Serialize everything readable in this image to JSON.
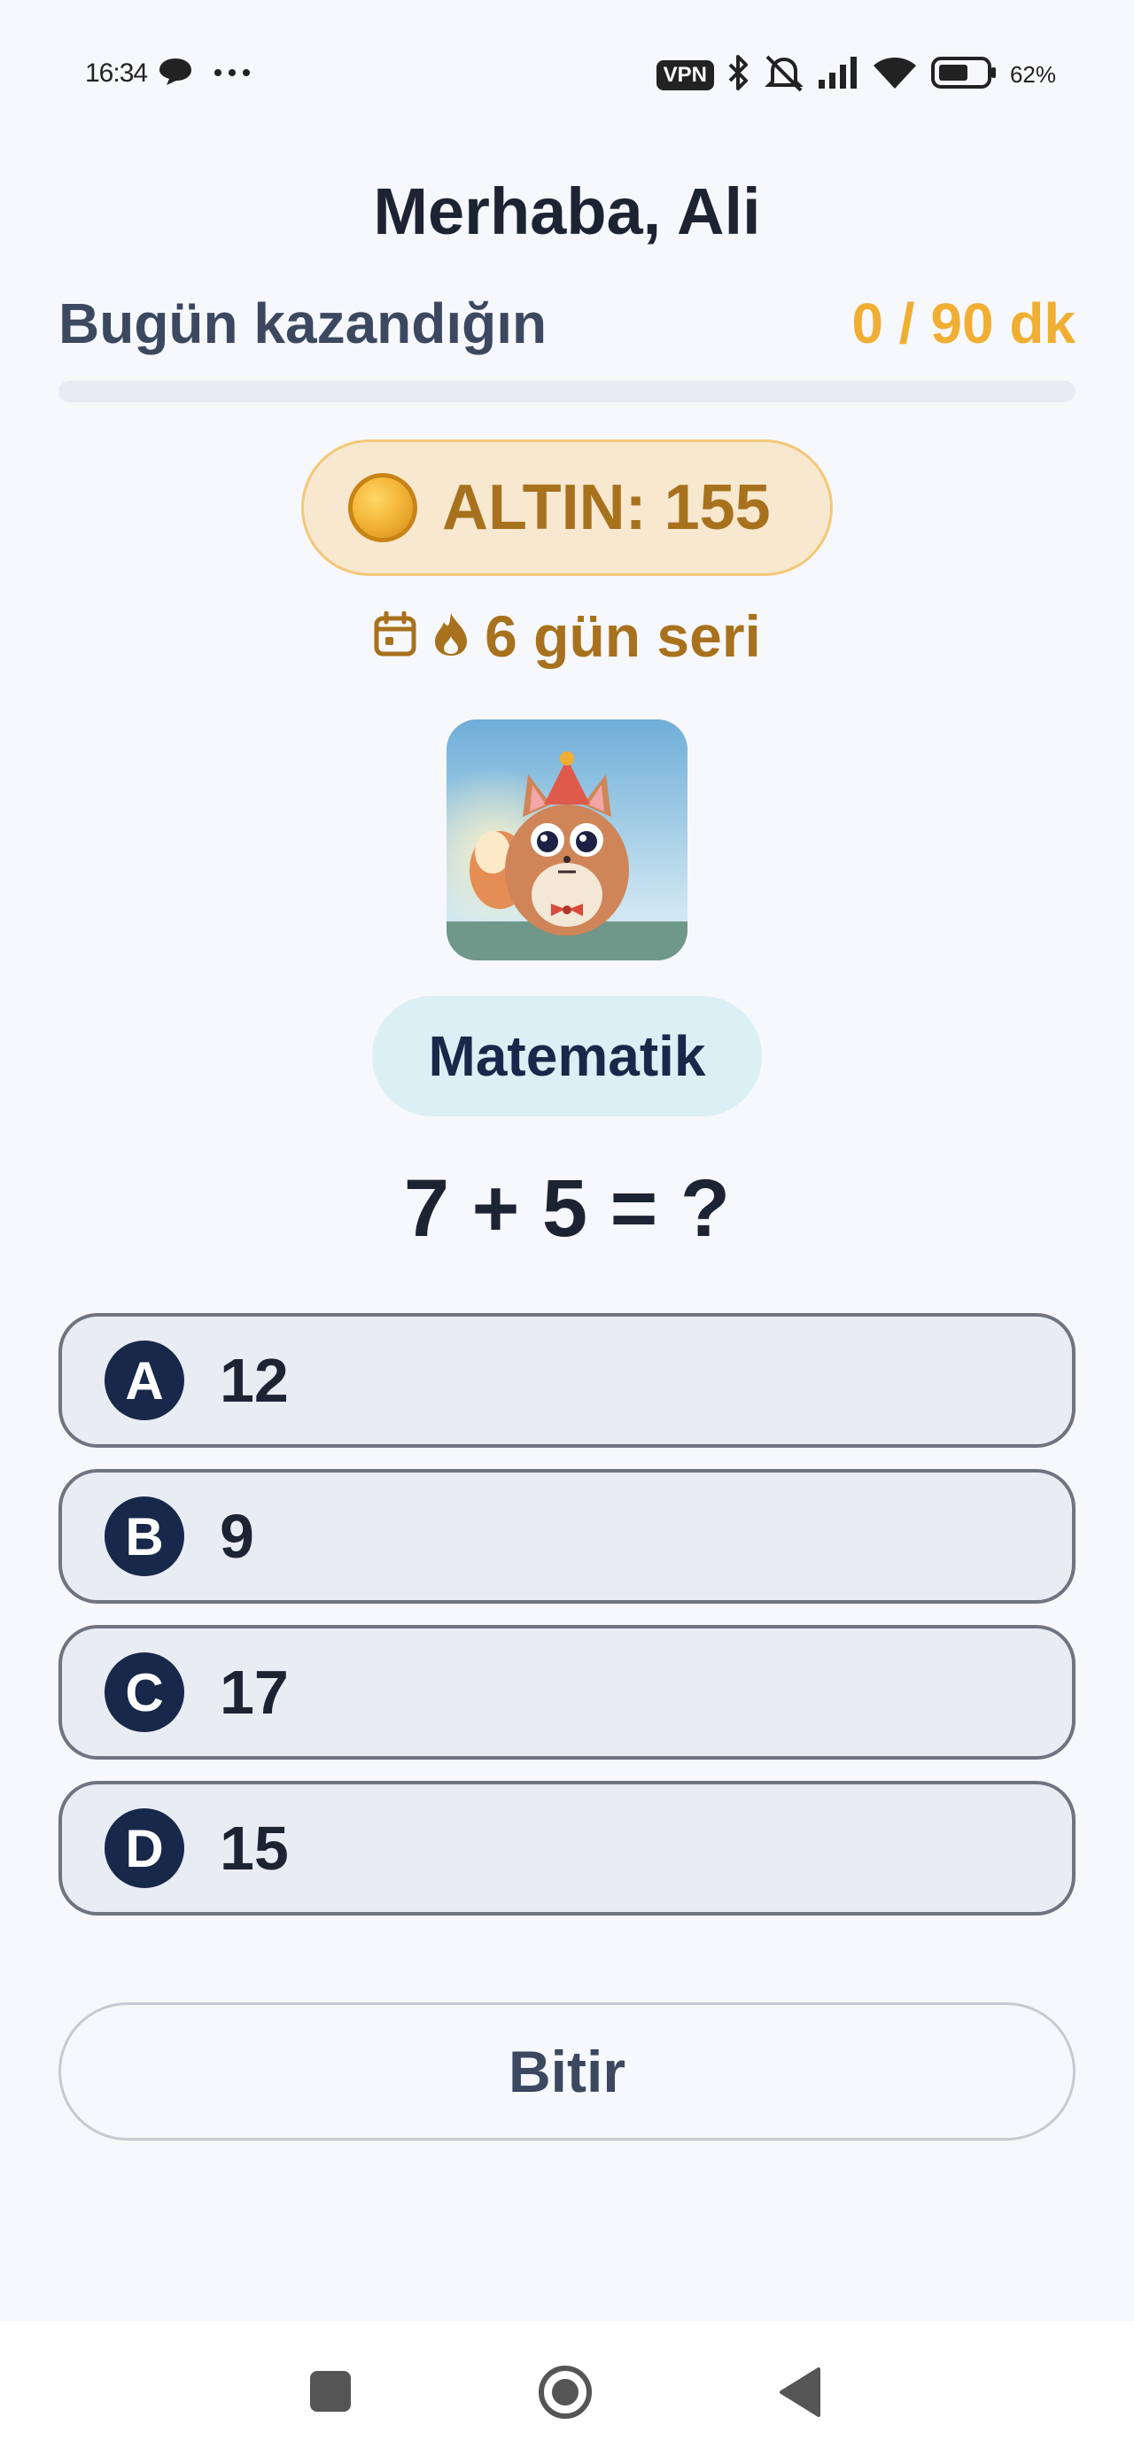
{
  "status_bar": {
    "time": "16:34",
    "vpn_label": "VPN",
    "battery_percent": "62%",
    "icons": [
      "chat-bubble-icon",
      "more-dots-icon",
      "bluetooth-icon",
      "mute-icon",
      "signal-icon",
      "wifi-icon",
      "battery-icon"
    ]
  },
  "header": {
    "greeting": "Merhaba, Ali",
    "earn_label": "Bugün kazandığın",
    "earn_value": "0 / 90 dk",
    "earn_progress_fraction": 0.0
  },
  "gold": {
    "label": "ALTIN: 155",
    "icon": "coin-icon"
  },
  "streak": {
    "label": "6 gün seri",
    "icons": [
      "calendar-icon",
      "flame-icon"
    ]
  },
  "mascot": {
    "icon": "fox-mascot-icon"
  },
  "subject": {
    "label": "Matematik"
  },
  "question": {
    "text": "7 + 5 = ?"
  },
  "options": [
    {
      "letter": "A",
      "value": "12"
    },
    {
      "letter": "B",
      "value": "9"
    },
    {
      "letter": "C",
      "value": "17"
    },
    {
      "letter": "D",
      "value": "15"
    }
  ],
  "finish_button": {
    "label": "Bitir"
  },
  "nav_bar": {
    "icons": [
      "recent-apps-icon",
      "home-icon",
      "back-icon"
    ]
  },
  "colors": {
    "accent_gold": "#f0ae32",
    "gold_text": "#a8711d",
    "navy": "#17284a",
    "background": "#f7f8fc"
  }
}
